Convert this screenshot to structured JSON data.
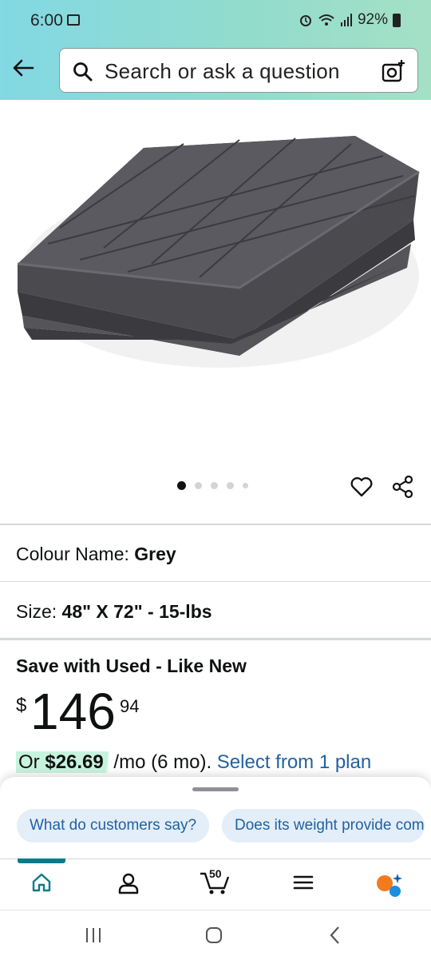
{
  "status": {
    "time": "6:00",
    "battery": "92%"
  },
  "search": {
    "placeholder": "Search or ask a question"
  },
  "product": {
    "colour_label": "Colour Name:",
    "colour_value": "Grey",
    "size_label": "Size:",
    "size_value": "48\" X 72\" - 15-lbs",
    "offer_title": "Save with Used - Like New",
    "price_symbol": "$",
    "price_whole": "146",
    "price_fraction": "94",
    "monthly_prefix": "Or",
    "monthly_amount": "$26.69",
    "monthly_term": "/mo (6 mo).",
    "monthly_link": "Select from 1 plan"
  },
  "carousel": {
    "total": 5,
    "active": 1
  },
  "chips": [
    "What do customers say?",
    "Does its weight provide com"
  ],
  "cart": {
    "count": "50"
  },
  "colors": {
    "accent_link": "#2162a1",
    "chip_bg": "#e3eef9",
    "nav_accent": "#0b7b8b",
    "highlight": "#c7f3de"
  },
  "icons": [
    "back-arrow-icon",
    "search-icon",
    "camera-icon",
    "heart-icon",
    "share-icon",
    "home-icon",
    "account-icon",
    "cart-icon",
    "menu-icon",
    "rufus-icon"
  ]
}
